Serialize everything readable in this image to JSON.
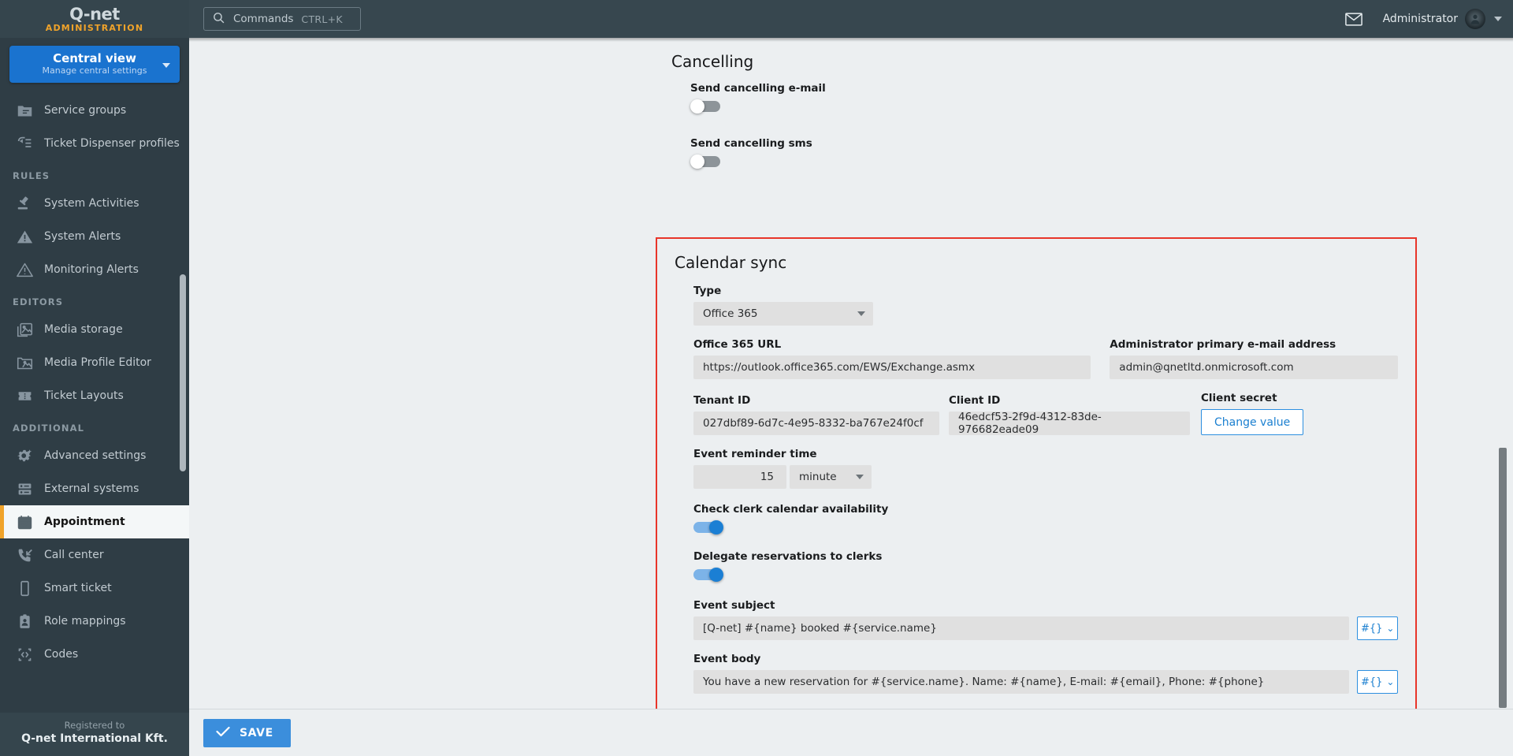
{
  "brand": {
    "logo": "Q-net",
    "subtitle": "ADMINISTRATION"
  },
  "view_switch": {
    "title": "Central view",
    "subtitle": "Manage central settings"
  },
  "topbar": {
    "commands_label": "Commands",
    "commands_shortcut": "CTRL+K",
    "user_name": "Administrator",
    "mail_icon": "envelope-icon",
    "avatar_icon": "user-avatar",
    "caret_icon": "chevron-down-icon"
  },
  "sidebar": {
    "items": [
      {
        "label": "Service groups",
        "icon": "folder-icon",
        "type": "item",
        "active": false
      },
      {
        "label": "Ticket Dispenser profiles",
        "icon": "ticket-dispenser-icon",
        "type": "item",
        "active": false
      },
      {
        "label": "RULES",
        "type": "section"
      },
      {
        "label": "System Activities",
        "icon": "gavel-icon",
        "type": "item",
        "active": false
      },
      {
        "label": "System Alerts",
        "icon": "alert-filled-icon",
        "type": "item",
        "active": false
      },
      {
        "label": "Monitoring Alerts",
        "icon": "alert-outline-icon",
        "type": "item",
        "active": false
      },
      {
        "label": "EDITORS",
        "type": "section"
      },
      {
        "label": "Media storage",
        "icon": "image-icon",
        "type": "item",
        "active": false
      },
      {
        "label": "Media Profile Editor",
        "icon": "image-folder-icon",
        "type": "item",
        "active": false
      },
      {
        "label": "Ticket Layouts",
        "icon": "ticket-icon",
        "type": "item",
        "active": false
      },
      {
        "label": "ADDITIONAL",
        "type": "section"
      },
      {
        "label": "Advanced settings",
        "icon": "gear-sparkle-icon",
        "type": "item",
        "active": false
      },
      {
        "label": "External systems",
        "icon": "server-icon",
        "type": "item",
        "active": false
      },
      {
        "label": "Appointment",
        "icon": "calendar-check-icon",
        "type": "item",
        "active": true
      },
      {
        "label": "Call center",
        "icon": "phone-incoming-icon",
        "type": "item",
        "active": false
      },
      {
        "label": "Smart ticket",
        "icon": "mobile-icon",
        "type": "item",
        "active": false
      },
      {
        "label": "Role mappings",
        "icon": "badge-person-icon",
        "type": "item",
        "active": false
      },
      {
        "label": "Codes",
        "icon": "code-icon",
        "type": "item",
        "active": false
      }
    ],
    "registered_label": "Registered to",
    "registered_company": "Q-net International Kft."
  },
  "main": {
    "cancelling": {
      "title": "Cancelling",
      "send_email_label": "Send cancelling e-mail",
      "send_email_on": false,
      "send_sms_label": "Send cancelling sms",
      "send_sms_on": false
    },
    "calendar_sync": {
      "title": "Calendar sync",
      "type_label": "Type",
      "type_value": "Office 365",
      "url_label": "Office 365 URL",
      "url_value": "https://outlook.office365.com/EWS/Exchange.asmx",
      "admin_email_label": "Administrator primary e-mail address",
      "admin_email_value": "admin@qnetltd.onmicrosoft.com",
      "tenant_id_label": "Tenant ID",
      "tenant_id_value": "027dbf89-6d7c-4e95-8332-ba767e24f0cf",
      "client_id_label": "Client ID",
      "client_id_value": "46edcf53-2f9d-4312-83de-976682eade09",
      "client_secret_label": "Client secret",
      "client_secret_button": "Change value",
      "reminder_label": "Event reminder time",
      "reminder_value": "15",
      "reminder_unit": "minute",
      "check_availability_label": "Check clerk calendar availability",
      "check_availability_on": true,
      "delegate_label": "Delegate reservations to clerks",
      "delegate_on": true,
      "event_subject_label": "Event subject",
      "event_subject_value": "[Q-net] #{name} booked #{service.name}",
      "event_body_label": "Event body",
      "event_body_value": "You have a new reservation for #{service.name}. Name: #{name}, E-mail: #{email}, Phone: #{phone}",
      "template_button_label": "#{}",
      "template_button_chevron": "⌄"
    }
  },
  "footer": {
    "save_label": "SAVE",
    "save_icon": "check-icon"
  },
  "colors": {
    "accent_blue": "#1a73cf",
    "sidebar_bg": "#2f3d45",
    "topbar_bg": "#37474f",
    "active_marker": "#f0a32a",
    "highlight_border": "#e8352a",
    "toggle_on": "#1b7fd4"
  }
}
